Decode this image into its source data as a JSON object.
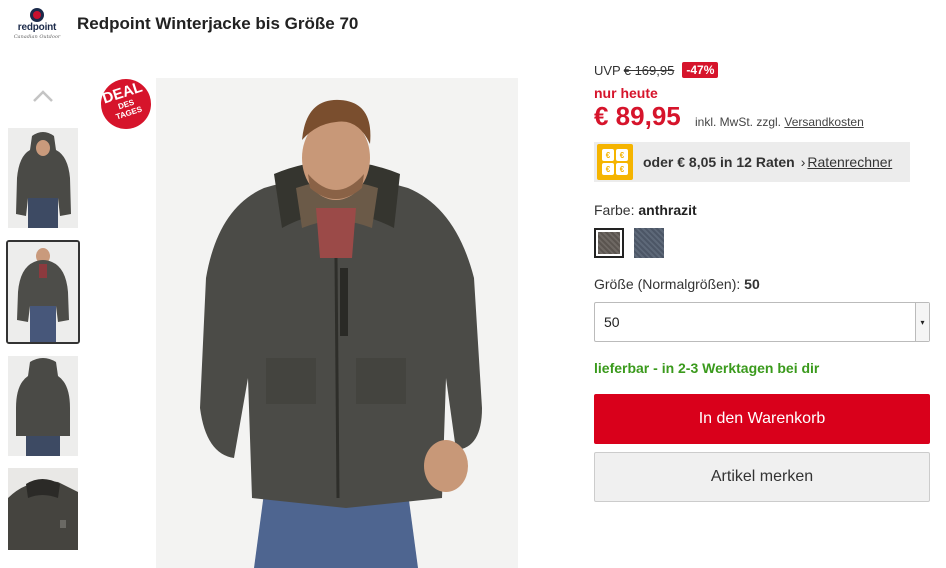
{
  "header": {
    "brand_name": "redpoint",
    "brand_tagline": "Canadian Outdoor",
    "title": "Redpoint Winterjacke bis Größe 70"
  },
  "gallery": {
    "deal_badge": {
      "line1": "DEAL",
      "line2": "DES",
      "line3": "TAGES"
    },
    "thumbnails_count": 4,
    "active_thumbnail": 2
  },
  "pricing": {
    "uvp_label": "UVP",
    "uvp_price": "€ 169,95",
    "discount": "-47%",
    "today_label": "nur heute",
    "price": "€ 89,95",
    "tax_note": "inkl. MwSt. zzgl.",
    "shipping_link": "Versandkosten"
  },
  "financing": {
    "text": "oder € 8,05 in 12 Raten",
    "chevron": "›",
    "link": "Ratenrechner",
    "icon_glyph": "€"
  },
  "color": {
    "label": "Farbe:",
    "selected": "anthrazit"
  },
  "size": {
    "label": "Größe (Normalgrößen):",
    "selected_label": "50",
    "select_value": "50",
    "arrow": "▾"
  },
  "availability": "lieferbar - in 2-3 Werktagen bei dir",
  "actions": {
    "cart": "In den Warenkorb",
    "wishlist": "Artikel merken"
  }
}
